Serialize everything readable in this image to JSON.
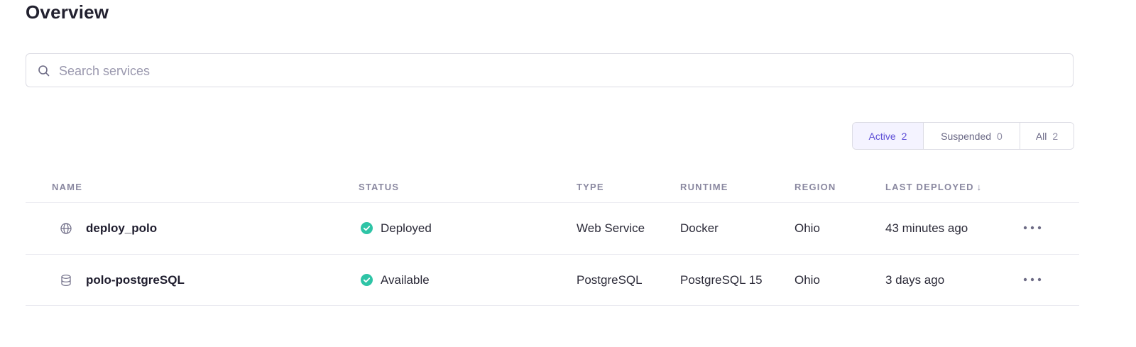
{
  "page": {
    "title": "Overview"
  },
  "search": {
    "placeholder": "Search services",
    "value": ""
  },
  "filters": [
    {
      "label": "Active",
      "count": "2",
      "selected": true
    },
    {
      "label": "Suspended",
      "count": "0",
      "selected": false
    },
    {
      "label": "All",
      "count": "2",
      "selected": false
    }
  ],
  "table": {
    "headers": {
      "name": "NAME",
      "status": "STATUS",
      "type": "TYPE",
      "runtime": "RUNTIME",
      "region": "REGION",
      "last_deployed": "LAST DEPLOYED",
      "sort_indicator": "↓"
    },
    "rows": [
      {
        "icon": "globe-icon",
        "name": "deploy_polo",
        "status": "Deployed",
        "type": "Web Service",
        "runtime": "Docker",
        "region": "Ohio",
        "last_deployed": "43 minutes ago"
      },
      {
        "icon": "database-icon",
        "name": "polo-postgreSQL",
        "status": "Available",
        "type": "PostgreSQL",
        "runtime": "PostgreSQL 15",
        "region": "Ohio",
        "last_deployed": "3 days ago"
      }
    ]
  },
  "colors": {
    "accent": "#5e4fd6",
    "status_ok": "#2ec4a6",
    "border": "#dcdce4",
    "muted_text": "#8a88a0"
  }
}
